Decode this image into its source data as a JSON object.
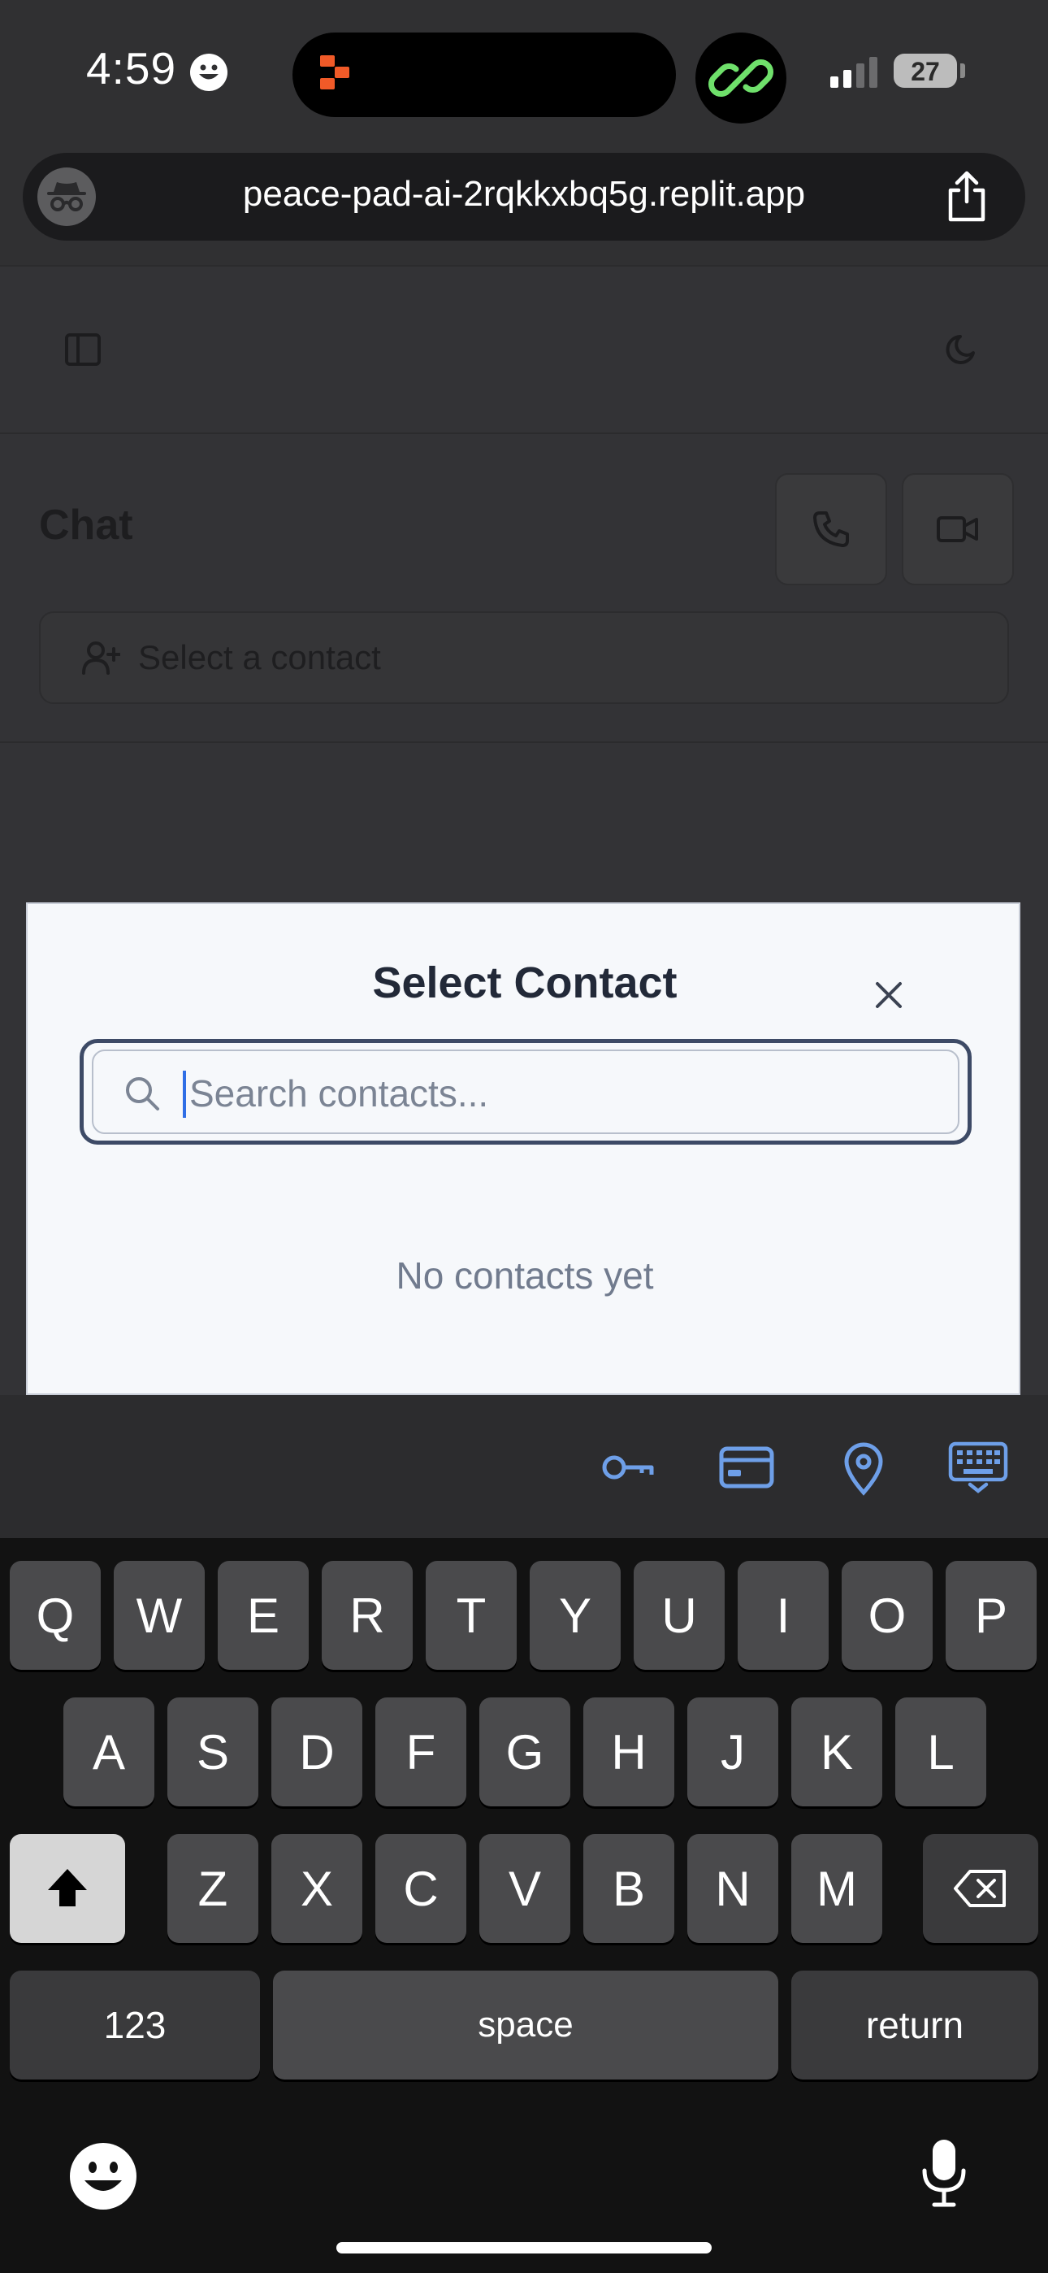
{
  "status_bar": {
    "time": "4:59",
    "battery": "27"
  },
  "browser": {
    "url": "peace-pad-ai-2rqkkxbq5g.replit.app"
  },
  "page": {
    "title": "Chat",
    "contact_select": "Select a contact"
  },
  "modal": {
    "title": "Select Contact",
    "search_placeholder": "Search contacts...",
    "search_value": "",
    "empty_message": "No contacts yet"
  },
  "keyboard": {
    "row1": [
      "Q",
      "W",
      "E",
      "R",
      "T",
      "Y",
      "U",
      "I",
      "O",
      "P"
    ],
    "row2": [
      "A",
      "S",
      "D",
      "F",
      "G",
      "H",
      "J",
      "K",
      "L"
    ],
    "row3": [
      "Z",
      "X",
      "C",
      "V",
      "B",
      "N",
      "M"
    ],
    "numbers_label": "123",
    "space_label": "space",
    "return_label": "return"
  },
  "colors": {
    "accent": "#2f6ee6",
    "autofill_icon": "#6e9fe8",
    "modal_bg": "#f6f8fb",
    "overlay_bg": "#333336"
  }
}
